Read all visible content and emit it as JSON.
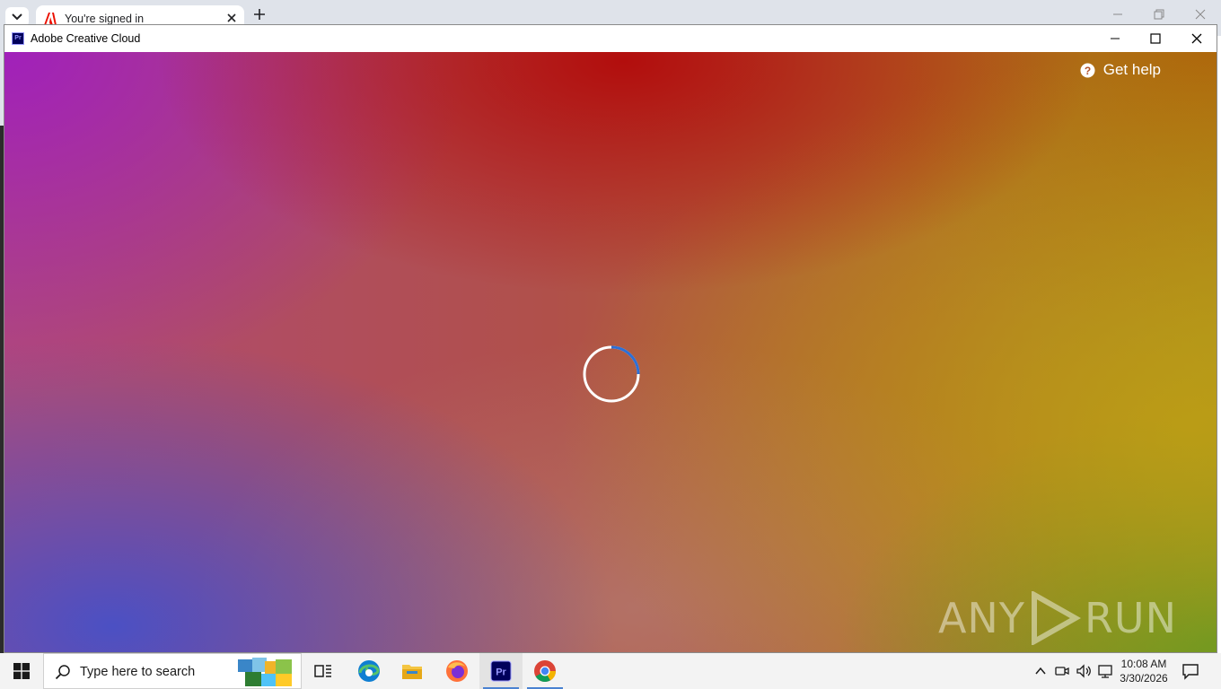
{
  "browser": {
    "tab_title": "You're signed in"
  },
  "window": {
    "app_icon_text": "Pr",
    "title": "Adobe Creative Cloud"
  },
  "content": {
    "help_label": "Get help",
    "loading": true
  },
  "watermark": {
    "left": "ANY",
    "right": "RUN"
  },
  "taskbar": {
    "search_placeholder": "Type here to search",
    "time": "10:08 AM",
    "date": "3/30/2026",
    "pinned": [
      "task-view",
      "edge",
      "file-explorer",
      "firefox",
      "premiere-pro",
      "chrome"
    ],
    "active": "premiere-pro"
  },
  "colors": {
    "accent": "#4a82d1",
    "premiere_bg": "#00005b",
    "premiere_fg": "#9999ff"
  }
}
